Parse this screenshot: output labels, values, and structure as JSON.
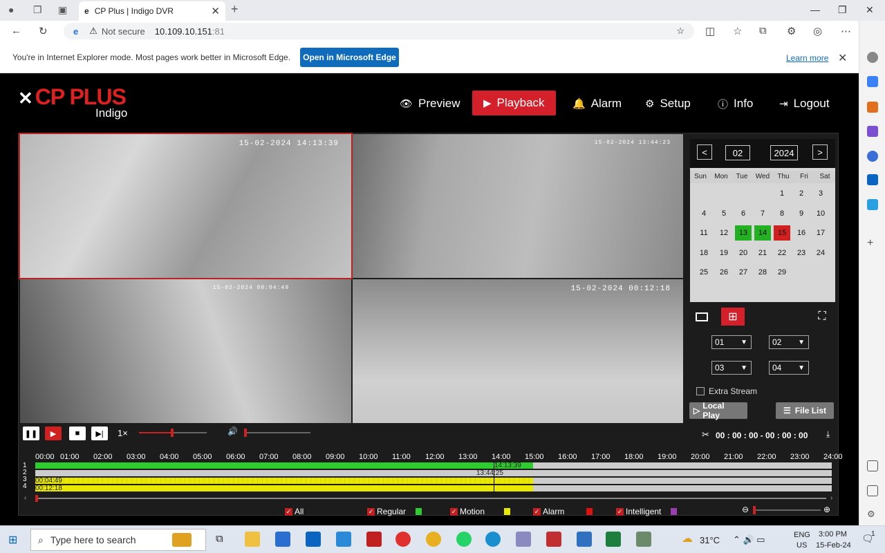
{
  "browser": {
    "tab_title": "CP Plus | Indigo DVR",
    "url_host": "10.109.10.151",
    "url_port": ":81",
    "not_secure": "Not secure",
    "ie_message": "You're in Internet Explorer mode. Most pages work better in Microsoft Edge.",
    "open_edge": "Open in Microsoft Edge",
    "learn_more": "Learn more"
  },
  "app": {
    "logo": "CP PLUS",
    "logo_sub": "Indigo",
    "nav": [
      "Preview",
      "Playback",
      "Alarm",
      "Setup",
      "Info",
      "Logout"
    ],
    "active_nav": "Playback"
  },
  "cameras": [
    {
      "timestamp": "15-02-2024 14:13:39",
      "selected": true
    },
    {
      "timestamp": "15-02-2024 13:44:23",
      "selected": false
    },
    {
      "timestamp": "15-02-2024 00:04:49",
      "selected": false
    },
    {
      "timestamp": "15-02-2024 00:12:18",
      "selected": false
    }
  ],
  "calendar": {
    "month": "02",
    "year": "2024",
    "dows": [
      "Sun",
      "Mon",
      "Tue",
      "Wed",
      "Thu",
      "Fri",
      "Sat"
    ],
    "days": [
      "1",
      "2",
      "3",
      "4",
      "5",
      "6",
      "7",
      "8",
      "9",
      "10",
      "11",
      "12",
      "13",
      "14",
      "15",
      "16",
      "17",
      "18",
      "19",
      "20",
      "21",
      "22",
      "23",
      "24",
      "25",
      "26",
      "27",
      "28",
      "29"
    ],
    "recorded_days": [
      "13",
      "14"
    ],
    "selected_day": "15"
  },
  "channels": [
    "01",
    "02",
    "03",
    "04"
  ],
  "extra_stream": "Extra Stream",
  "local_play": "Local Play",
  "file_list": "File List",
  "speed": "1×",
  "time_range": "00 : 00 : 00 - 00 : 00 : 00",
  "timeline": {
    "hours": [
      "00:00",
      "01:00",
      "02:00",
      "03:00",
      "04:00",
      "05:00",
      "06:00",
      "07:00",
      "08:00",
      "09:00",
      "10:00",
      "11:00",
      "12:00",
      "13:00",
      "14:00",
      "15:00",
      "16:00",
      "17:00",
      "18:00",
      "19:00",
      "20:00",
      "21:00",
      "22:00",
      "23:00",
      "24:00"
    ],
    "tracks": [
      "1",
      "2",
      "3",
      "4"
    ],
    "track1_time": "14:13:39",
    "track2_time": "13:44:25",
    "track3_time": "00:04:49",
    "track4_time": "00:12:18"
  },
  "legend": [
    "All",
    "Regular",
    "Motion",
    "Alarm",
    "Intelligent"
  ],
  "legend_colors": {
    "Regular": "#2ecc2e",
    "Motion": "#e8e800",
    "Alarm": "#e01010",
    "Intelligent": "#9b3fb0"
  },
  "taskbar": {
    "search_placeholder": "Type here to search",
    "temp": "31°C",
    "lang": "ENG",
    "region": "US",
    "time": "3:00 PM",
    "date": "15-Feb-24",
    "notif": "1"
  }
}
